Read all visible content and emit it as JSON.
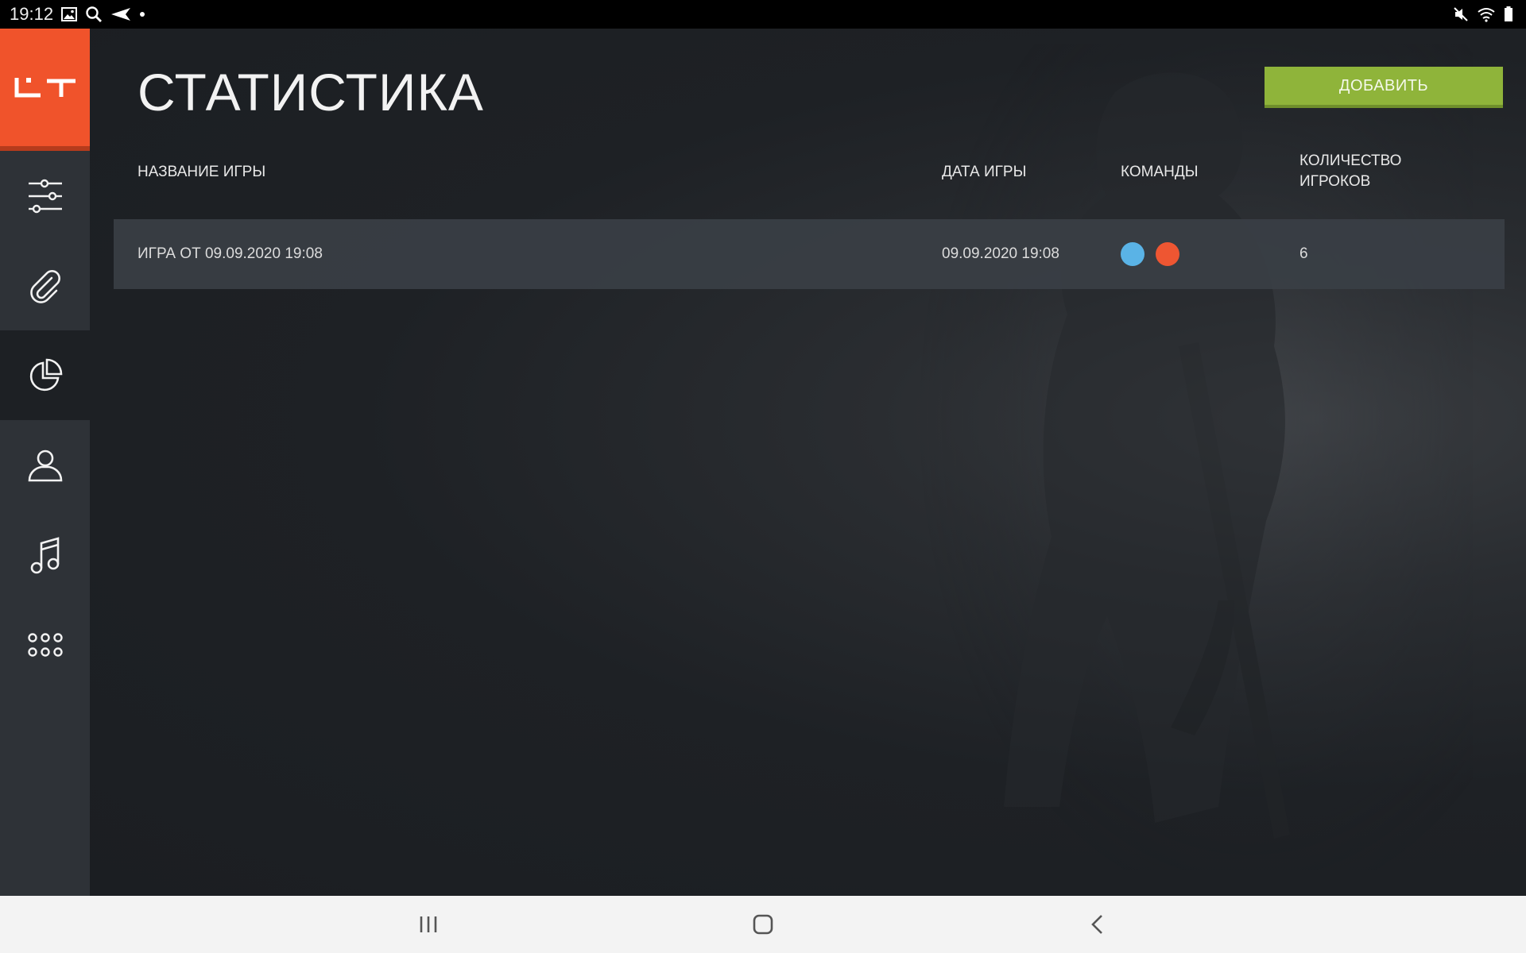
{
  "statusbar": {
    "time": "19:12",
    "left_icons": [
      "gallery-icon",
      "search-icon",
      "send-icon",
      "dot-icon"
    ],
    "right_icons": [
      "mute-icon",
      "wifi-icon",
      "battery-icon"
    ]
  },
  "sidebar": {
    "logo": "LT",
    "items": [
      {
        "name": "settings-sliders-icon",
        "active": false
      },
      {
        "name": "paperclip-icon",
        "active": false
      },
      {
        "name": "pie-chart-icon",
        "active": true
      },
      {
        "name": "user-icon",
        "active": false
      },
      {
        "name": "music-note-icon",
        "active": false
      },
      {
        "name": "apps-grid-icon",
        "active": false
      }
    ]
  },
  "header": {
    "title": "СТАТИСТИКА",
    "add_button_label": "ДОБАВИТЬ"
  },
  "table": {
    "columns": {
      "name": "НАЗВАНИЕ ИГРЫ",
      "date": "ДАТА ИГРЫ",
      "teams": "КОМАНДЫ",
      "players": "КОЛИЧЕСТВО ИГРОКОВ"
    },
    "rows": [
      {
        "name": "ИГРА ОТ 09.09.2020 19:08",
        "date": "09.09.2020 19:08",
        "teams": [
          "#5ab3e6",
          "#ee5632"
        ],
        "players": "6"
      }
    ]
  },
  "colors": {
    "accent": "#f0532b",
    "add_button": "#8fb43a",
    "sidebar": "#2e3237",
    "background": "#1b1e22"
  },
  "navbar": {
    "buttons": [
      "recent-apps-icon",
      "home-icon",
      "back-icon"
    ]
  }
}
